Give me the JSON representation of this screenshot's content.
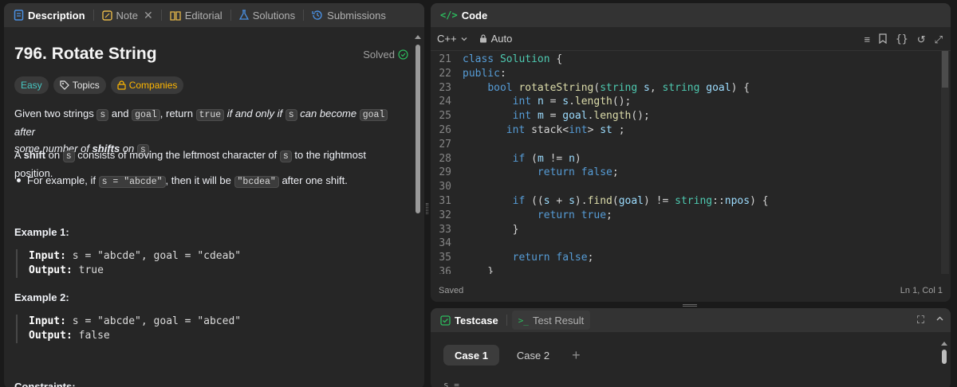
{
  "left_tabs": [
    {
      "label": "Description",
      "icon": "description-icon",
      "color": "#4a90e2"
    },
    {
      "label": "Note",
      "icon": "note-icon",
      "color": "#e6b84a"
    },
    {
      "label": "Editorial",
      "icon": "editorial-icon",
      "color": "#e6b84a"
    },
    {
      "label": "Solutions",
      "icon": "solutions-icon",
      "color": "#4a90e2"
    },
    {
      "label": "Submissions",
      "icon": "submissions-icon",
      "color": "#4a90e2"
    }
  ],
  "problem": {
    "title": "796. Rotate String",
    "status": "Solved",
    "tags": {
      "difficulty": "Easy",
      "topics": "Topics",
      "companies": "Companies"
    },
    "para1": {
      "t1": "Given two strings ",
      "c1": "s",
      "t2": " and ",
      "c2": "goal",
      "t3": ", return ",
      "c3": "true",
      "t4": " if and only if ",
      "c4": "s",
      "t5": " can become ",
      "c5": "goal",
      "t6": " after",
      "t7": "some number of ",
      "t8": "shifts",
      "t9": " on ",
      "c6": "s",
      "t10": "."
    },
    "para2": {
      "t1": "A ",
      "t2": "shift",
      "t3": " on ",
      "c1": "s",
      "t4": " consists of moving the leftmost character of ",
      "c2": "s",
      "t5": " to the rightmost position."
    },
    "bullet": {
      "t1": "For example, if ",
      "c1": "s = \"abcde\"",
      "t2": ", then it will be ",
      "c2": "\"bcdea\"",
      "t3": " after one shift."
    },
    "examples": [
      {
        "title": "Example 1:",
        "input_label": "Input:",
        "input": " s = \"abcde\", goal = \"cdeab\"",
        "output_label": "Output:",
        "output": " true"
      },
      {
        "title": "Example 2:",
        "input_label": "Input:",
        "input": " s = \"abcde\", goal = \"abced\"",
        "output_label": "Output:",
        "output": " false"
      }
    ],
    "constraints_title": "Constraints:"
  },
  "code_panel": {
    "title": "Code",
    "language": "C++",
    "mode": "Auto",
    "status": "Saved",
    "cursor": "Ln 1, Col 1",
    "lines": [
      {
        "n": "21",
        "code": "class Solution {"
      },
      {
        "n": "22",
        "code": "public:"
      },
      {
        "n": "23",
        "code": "    bool rotateString(string s, string goal) {"
      },
      {
        "n": "24",
        "code": "        int n = s.length();"
      },
      {
        "n": "25",
        "code": "        int m = goal.length();"
      },
      {
        "n": "26",
        "code": "       int stack<int> st ;"
      },
      {
        "n": "27",
        "code": ""
      },
      {
        "n": "28",
        "code": "        if (m != n)"
      },
      {
        "n": "29",
        "code": "            return false;"
      },
      {
        "n": "30",
        "code": ""
      },
      {
        "n": "31",
        "code": "        if ((s + s).find(goal) != string::npos) {"
      },
      {
        "n": "32",
        "code": "            return true;"
      },
      {
        "n": "33",
        "code": "        }"
      },
      {
        "n": "34",
        "code": ""
      },
      {
        "n": "35",
        "code": "        return false;"
      },
      {
        "n": "36",
        "code": "    }"
      }
    ]
  },
  "test_panel": {
    "tabs": [
      "Testcase",
      "Test Result"
    ],
    "cases": [
      "Case 1",
      "Case 2"
    ],
    "add": "+",
    "var_label": "s ="
  }
}
